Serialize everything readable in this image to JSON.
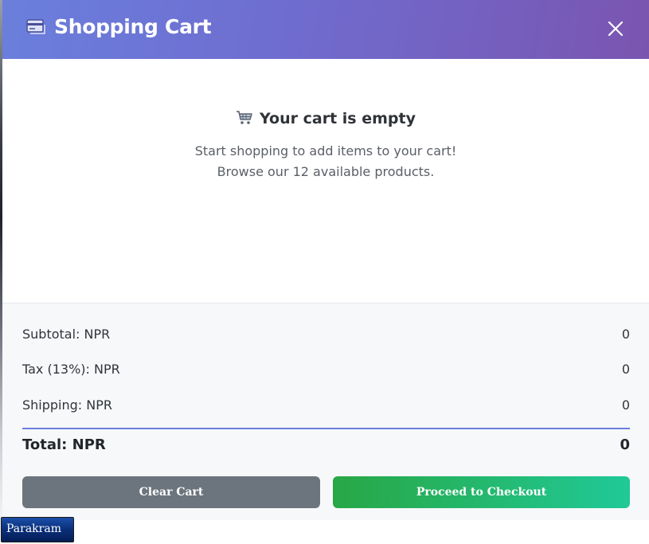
{
  "modal": {
    "title": "Shopping Cart",
    "header_icon": "credit-card-icon",
    "close_icon": "close-icon"
  },
  "empty_state": {
    "icon": "shopping-cart-icon",
    "title": "Your cart is empty",
    "line1": "Start shopping to add items to your cart!",
    "line2": "Browse our 12 available products."
  },
  "summary": {
    "subtotal_label": "Subtotal: NPR",
    "subtotal_value": "0",
    "tax_label": "Tax (13%): NPR",
    "tax_value": "0",
    "shipping_label": "Shipping: NPR",
    "shipping_value": "0",
    "total_label": "Total: NPR",
    "total_value": "0"
  },
  "actions": {
    "clear_label": "Clear Cart",
    "checkout_label": "Proceed to Checkout"
  },
  "taskbar": {
    "label": "Parakram"
  },
  "colors": {
    "header_gradient_start": "#6a7fdc",
    "header_gradient_end": "#7a55b0",
    "clear_button": "#6c757d",
    "checkout_gradient_start": "#28a745",
    "checkout_gradient_end": "#20c997",
    "divider": "#6a7fdc"
  }
}
